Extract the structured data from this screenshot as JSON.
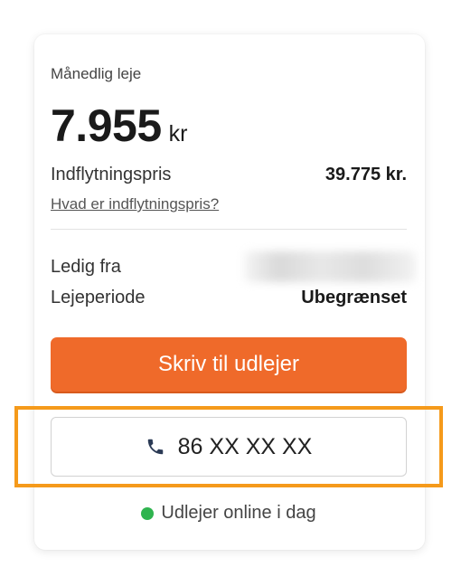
{
  "listing": {
    "monthly_label": "Månedlig leje",
    "price": "7.955",
    "price_unit": "kr",
    "move_in_label": "Indflytningspris",
    "move_in_value": "39.775 kr.",
    "help_link": "Hvad er indflytningspris?",
    "available_label": "Ledig fra",
    "period_label": "Lejeperiode",
    "period_value": "Ubegrænset"
  },
  "actions": {
    "contact_label": "Skriv til udlejer",
    "phone_label": "86 XX XX XX"
  },
  "status": {
    "text": "Udlejer online i dag",
    "dot_color": "#2fb44f"
  },
  "colors": {
    "accent": "#ef6a2a",
    "highlight": "#f59a1b",
    "phone_icon": "#2b3a55"
  }
}
